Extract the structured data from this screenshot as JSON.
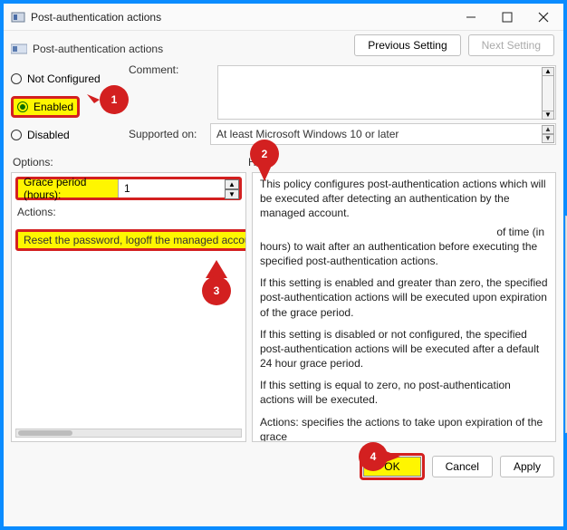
{
  "window": {
    "title": "Post-authentication actions",
    "header_title": "Post-authentication actions"
  },
  "nav": {
    "previous": "Previous Setting",
    "next": "Next Setting"
  },
  "radios": {
    "not_configured": "Not Configured",
    "enabled": "Enabled",
    "disabled": "Disabled",
    "selected": "enabled"
  },
  "labels": {
    "comment": "Comment:",
    "supported_on": "Supported on:",
    "options": "Options:",
    "help": "Help:",
    "actions": "Actions:"
  },
  "supported_on_value": "At least Microsoft Windows 10 or later",
  "options": {
    "grace_label": "Grace period (hours):",
    "grace_value": "1",
    "actions_value": "Reset the password, logoff the managed account, and terminate any remaining processes"
  },
  "help": {
    "p1": "This policy configures post-authentication actions which will be executed after detecting an authentication by the managed account.",
    "p2_tail": " of time (in hours) to wait after an authentication before executing the specified post-authentication actions.",
    "p3": "If this setting is enabled and greater than zero, the specified post-authentication actions will be executed upon expiration of the grace period.",
    "p4": "If this setting is disabled or not configured, the specified post-authentication actions will be executed after a default 24 hour grace period.",
    "p5": "If this setting is equal to zero, no post-authentication actions will be executed.",
    "p6": "Actions: specifies the actions to take upon expiration of the grace"
  },
  "buttons": {
    "ok": "OK",
    "cancel": "Cancel",
    "apply": "Apply"
  },
  "annotations": {
    "b1": "1",
    "b2": "2",
    "b3": "3",
    "b4": "4"
  },
  "colors": {
    "frame": "#0a8cff",
    "annotation_red": "#d32020",
    "highlight": "#fff600"
  }
}
